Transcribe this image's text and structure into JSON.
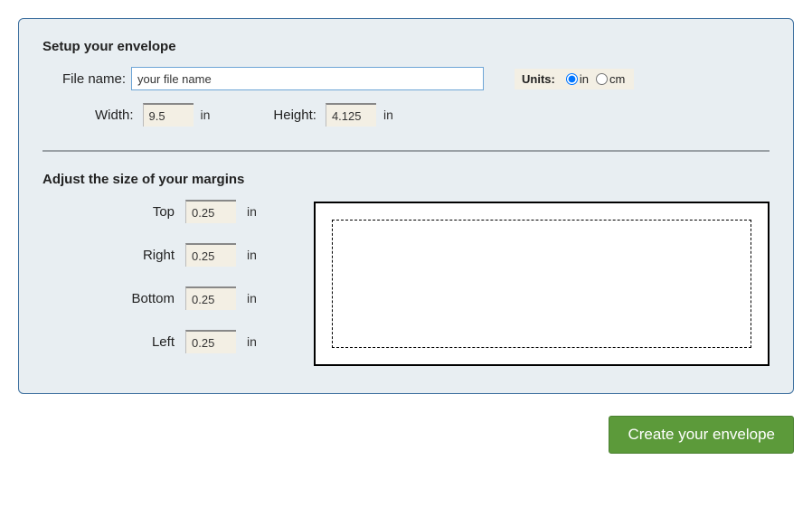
{
  "setup": {
    "heading": "Setup your envelope",
    "filename_label": "File name:",
    "filename_value": "your file name",
    "units_label": "Units:",
    "unit_in": "in",
    "unit_cm": "cm",
    "unit_selected": "in",
    "width_label": "Width:",
    "width_value": "9.5",
    "height_label": "Height:",
    "height_value": "4.125",
    "dim_unit": "in"
  },
  "margins": {
    "heading": "Adjust the size of your margins",
    "top_label": "Top",
    "top_value": "0.25",
    "right_label": "Right",
    "right_value": "0.25",
    "bottom_label": "Bottom",
    "bottom_value": "0.25",
    "left_label": "Left",
    "left_value": "0.25",
    "unit": "in"
  },
  "action": {
    "create_label": "Create your envelope"
  }
}
